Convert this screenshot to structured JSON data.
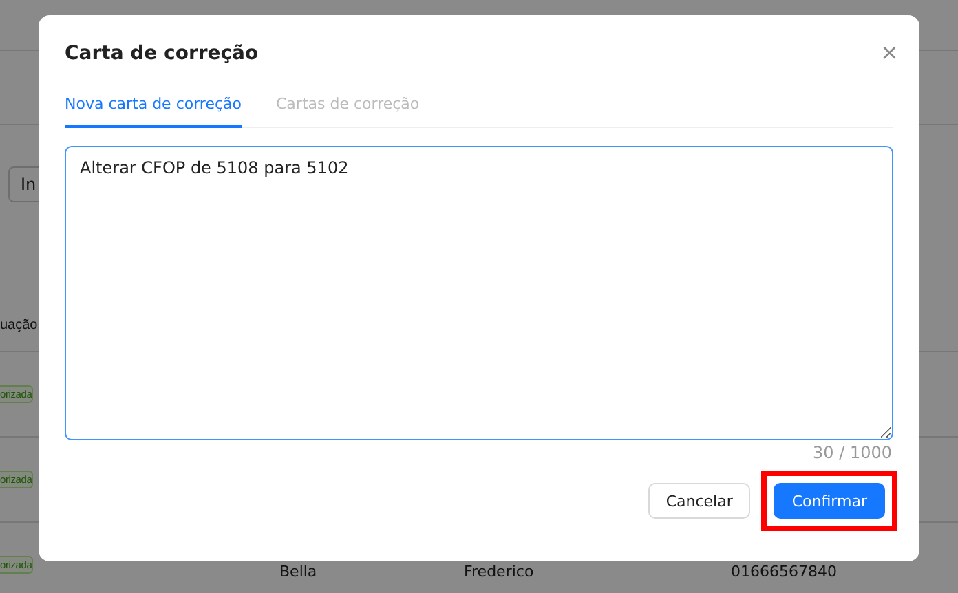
{
  "background": {
    "toolbar_button": "In",
    "table": {
      "header": "uação",
      "rows": [
        {
          "status": "orizada"
        },
        {
          "status": "orizada"
        },
        {
          "status": "orizada"
        }
      ],
      "last_row": [
        "Bella",
        "Frederico",
        "01666567840"
      ]
    }
  },
  "dialog": {
    "title": "Carta de correção",
    "close": "×",
    "tabs": [
      {
        "label": "Nova carta de correção",
        "selected": true
      },
      {
        "label": "Cartas de correção",
        "selected": false
      }
    ],
    "text": {
      "value": "Alterar CFOP de 5108 para 5102",
      "counter": "30 / 1000"
    },
    "buttons": [
      {
        "label": "Cancelar",
        "kind": "default",
        "highlighted": false
      },
      {
        "label": "Confirmar",
        "kind": "primary",
        "highlighted": true
      }
    ]
  }
}
